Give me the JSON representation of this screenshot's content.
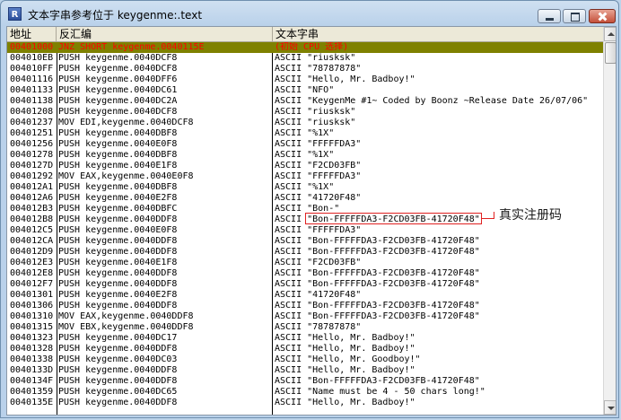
{
  "window": {
    "app_icon": "R",
    "title": "文本字串参考位于 keygenme:.text",
    "buttons": {
      "minimize": "minimize-icon",
      "maximize": "maximize-icon",
      "close": "close-icon"
    }
  },
  "columns": [
    "地址",
    "反汇编",
    "文本字串"
  ],
  "rows": [
    {
      "addr": "00401000",
      "disasm": "JNZ SHORT keygenme.0040115E",
      "text": "(初始 CPU 选择)",
      "selected": true
    },
    {
      "addr": "004010EB",
      "disasm": "PUSH keygenme.0040DCF8",
      "text": "ASCII \"riusksk\""
    },
    {
      "addr": "004010FF",
      "disasm": "PUSH keygenme.0040DCF8",
      "text": "ASCII \"78787878\""
    },
    {
      "addr": "00401116",
      "disasm": "PUSH keygenme.0040DFF6",
      "text": "ASCII \"Hello, Mr. Badboy!\""
    },
    {
      "addr": "00401133",
      "disasm": "PUSH keygenme.0040DC61",
      "text": "ASCII \"NFO\""
    },
    {
      "addr": "00401138",
      "disasm": "PUSH keygenme.0040DC2A",
      "text": "ASCII \"KeygenMe #1~ Coded by Boonz ~Release Date 26/07/06\""
    },
    {
      "addr": "00401208",
      "disasm": "PUSH keygenme.0040DCF8",
      "text": "ASCII \"riusksk\""
    },
    {
      "addr": "00401237",
      "disasm": "MOV EDI,keygenme.0040DCF8",
      "text": "ASCII \"riusksk\""
    },
    {
      "addr": "00401251",
      "disasm": "PUSH keygenme.0040DBF8",
      "text": "ASCII \"%1X\""
    },
    {
      "addr": "00401256",
      "disasm": "PUSH keygenme.0040E0F8",
      "text": "ASCII \"FFFFFDA3\""
    },
    {
      "addr": "00401278",
      "disasm": "PUSH keygenme.0040DBF8",
      "text": "ASCII \"%1X\""
    },
    {
      "addr": "0040127D",
      "disasm": "PUSH keygenme.0040E1F8",
      "text": "ASCII \"F2CD03FB\""
    },
    {
      "addr": "00401292",
      "disasm": "MOV EAX,keygenme.0040E0F8",
      "text": "ASCII \"FFFFFDA3\""
    },
    {
      "addr": "004012A1",
      "disasm": "PUSH keygenme.0040DBF8",
      "text": "ASCII \"%1X\""
    },
    {
      "addr": "004012A6",
      "disasm": "PUSH keygenme.0040E2F8",
      "text": "ASCII \"41720F48\""
    },
    {
      "addr": "004012B3",
      "disasm": "PUSH keygenme.0040DBFC",
      "text": "ASCII \"Bon-\""
    },
    {
      "addr": "004012B8",
      "disasm": "PUSH keygenme.0040DDF8",
      "text": "ASCII \"Bon-FFFFFDA3-F2CD03FB-41720F48\""
    },
    {
      "addr": "004012C5",
      "disasm": "PUSH keygenme.0040E0F8",
      "text": "ASCII \"FFFFFDA3\""
    },
    {
      "addr": "004012CA",
      "disasm": "PUSH keygenme.0040DDF8",
      "text": "ASCII \"Bon-FFFFFDA3-F2CD03FB-41720F48\""
    },
    {
      "addr": "004012D9",
      "disasm": "PUSH keygenme.0040DDF8",
      "text": "ASCII \"Bon-FFFFFDA3-F2CD03FB-41720F48\""
    },
    {
      "addr": "004012E3",
      "disasm": "PUSH keygenme.0040E1F8",
      "text": "ASCII \"F2CD03FB\""
    },
    {
      "addr": "004012E8",
      "disasm": "PUSH keygenme.0040DDF8",
      "text": "ASCII \"Bon-FFFFFDA3-F2CD03FB-41720F48\""
    },
    {
      "addr": "004012F7",
      "disasm": "PUSH keygenme.0040DDF8",
      "text": "ASCII \"Bon-FFFFFDA3-F2CD03FB-41720F48\""
    },
    {
      "addr": "00401301",
      "disasm": "PUSH keygenme.0040E2F8",
      "text": "ASCII \"41720F48\""
    },
    {
      "addr": "00401306",
      "disasm": "PUSH keygenme.0040DDF8",
      "text": "ASCII \"Bon-FFFFFDA3-F2CD03FB-41720F48\""
    },
    {
      "addr": "00401310",
      "disasm": "MOV EAX,keygenme.0040DDF8",
      "text": "ASCII \"Bon-FFFFFDA3-F2CD03FB-41720F48\""
    },
    {
      "addr": "00401315",
      "disasm": "MOV EBX,keygenme.0040DDF8",
      "text": "ASCII \"78787878\""
    },
    {
      "addr": "00401323",
      "disasm": "PUSH keygenme.0040DC17",
      "text": "ASCII \"Hello, Mr. Badboy!\""
    },
    {
      "addr": "00401328",
      "disasm": "PUSH keygenme.0040DDF8",
      "text": "ASCII \"Hello, Mr. Badboy!\""
    },
    {
      "addr": "00401338",
      "disasm": "PUSH keygenme.0040DC03",
      "text": "ASCII \"Hello, Mr. Goodboy!\""
    },
    {
      "addr": "0040133D",
      "disasm": "PUSH keygenme.0040DDF8",
      "text": "ASCII \"Hello, Mr. Badboy!\""
    },
    {
      "addr": "0040134F",
      "disasm": "PUSH keygenme.0040DDF8",
      "text": "ASCII \"Bon-FFFFFDA3-F2CD03FB-41720F48\""
    },
    {
      "addr": "00401359",
      "disasm": "PUSH keygenme.0040DC65",
      "text": "ASCII \"Name must be 4 - 50 chars long!\""
    },
    {
      "addr": "0040135E",
      "disasm": "PUSH keygenme.0040DDF8",
      "text": "ASCII \"Hello, Mr. Badboy!\""
    }
  ],
  "annotation": {
    "label": "真实注册码"
  },
  "colors": {
    "selected_row_bg": "#7f8100",
    "selected_row_text": "#ff0000",
    "annotation": "#e02020"
  }
}
